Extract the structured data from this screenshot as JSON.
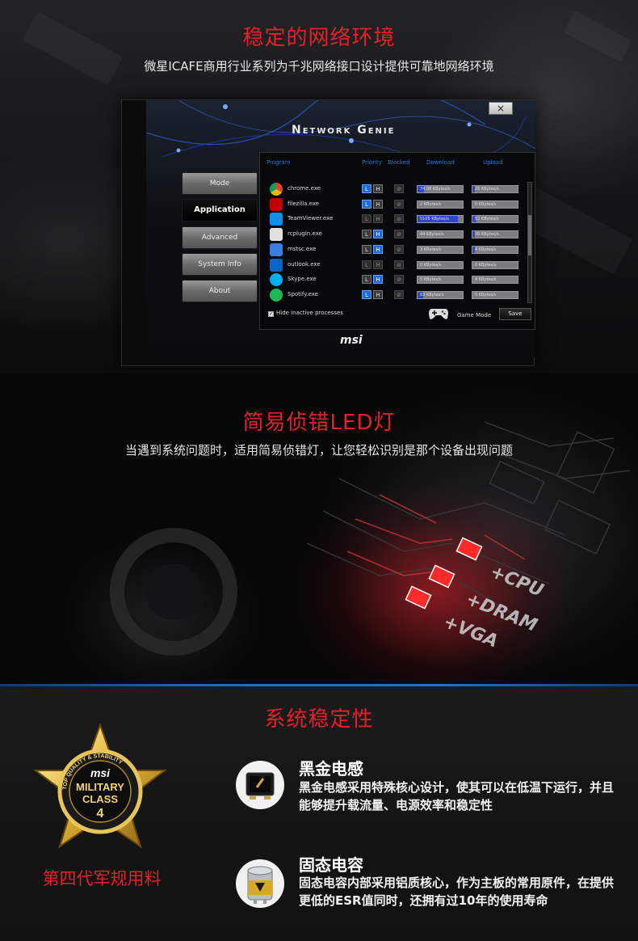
{
  "section1": {
    "title": "稳定的网络环境",
    "subtitle": "微星ICAFE商用行业系列为千兆网络接口设计提供可靠地网络环境"
  },
  "window": {
    "close_label": "×",
    "app_title": "Network Genie",
    "sidebar": [
      {
        "label": "Mode",
        "active": false
      },
      {
        "label": "Application",
        "active": true
      },
      {
        "label": "Advanced",
        "active": false
      },
      {
        "label": "System Info",
        "active": false
      },
      {
        "label": "About",
        "active": false
      }
    ],
    "columns": {
      "program": "Program",
      "priority": "Priority",
      "blocked": "Blocked",
      "download": "Download",
      "upload": "Upload"
    },
    "priority_low": "L",
    "priority_high": "H",
    "rows": [
      {
        "name": "chrome.exe",
        "icon": "chrome-icon",
        "prio": "L",
        "download": "74.08 KBytes/s",
        "dl_fill": 0.15,
        "upload": "25 KBytes/s",
        "ul_fill": 0.05
      },
      {
        "name": "filezilla.exe",
        "icon": "filezilla-icon",
        "prio": "L",
        "download": "2 KBytes/s",
        "dl_fill": 0,
        "upload": "0 KBytes/s",
        "ul_fill": 0
      },
      {
        "name": "TeamViewer.exe",
        "icon": "teamviewer-icon",
        "prio": "none",
        "download": "5105 KBytes/s",
        "dl_fill": 0.9,
        "upload": "52 KBytes/s",
        "ul_fill": 0.08
      },
      {
        "name": "rcplugin.exe",
        "icon": "rcplugin-icon",
        "prio": "H",
        "download": "44 KBytes/s",
        "dl_fill": 0,
        "upload": "20 KBytes/s",
        "ul_fill": 0.05
      },
      {
        "name": "mstsc.exe",
        "icon": "mstsc-icon",
        "prio": "H",
        "download": "3 KBytes/s",
        "dl_fill": 0,
        "upload": "4 KBytes/s",
        "ul_fill": 0.06
      },
      {
        "name": "outlook.exe",
        "icon": "outlook-icon",
        "prio": "none",
        "download": "0 KBytes/s",
        "dl_fill": 0,
        "upload": "0 KBytes/s",
        "ul_fill": 0
      },
      {
        "name": "Skype.exe",
        "icon": "skype-icon",
        "prio": "H",
        "download": "5 KBytes/s",
        "dl_fill": 0,
        "upload": "4 KBytes/s",
        "ul_fill": 0
      },
      {
        "name": "Spotify.exe",
        "icon": "spotify-icon",
        "prio": "L",
        "download": "63 KBytes/s",
        "dl_fill": 0.12,
        "upload": "5 KBytes/s",
        "ul_fill": 0
      }
    ],
    "hide_inactive_label": "Hide inactive processes",
    "game_mode_label": "Game Mode",
    "save_label": "Save",
    "brand": "msi"
  },
  "section2": {
    "title": "简易侦错LED灯",
    "subtitle": "当遇到系统问题时，适用简易侦错灯，让您轻松识别是那个设备出现问题",
    "led_labels": [
      "+CPU",
      "+DRAM",
      "+VGA"
    ]
  },
  "section3": {
    "title": "系统稳定性",
    "badge": {
      "brand": "msi",
      "line1": "MILITARY",
      "line2": "CLASS",
      "number": "4",
      "ring_text": "TOP QUALITY & STABILITY",
      "caption": "第四代军规用料"
    },
    "features": [
      {
        "icon": "choke-icon",
        "title": "黑金电感",
        "desc": "黑金电感采用特殊核心设计，使其可以在低温下运行，并且能够提升载流量、电源效率和稳定性"
      },
      {
        "icon": "capacitor-icon",
        "title": "固态电容",
        "desc": "固态电容内部采用铝质核心，作为主板的常用原件，在提供更低的ESR值同时，还拥有过10年的使用寿命"
      }
    ]
  },
  "colors": {
    "accent_red": "#e5202a",
    "divider_blue": "#1e72c8",
    "bar_fill_blue": "#2f45d6"
  }
}
